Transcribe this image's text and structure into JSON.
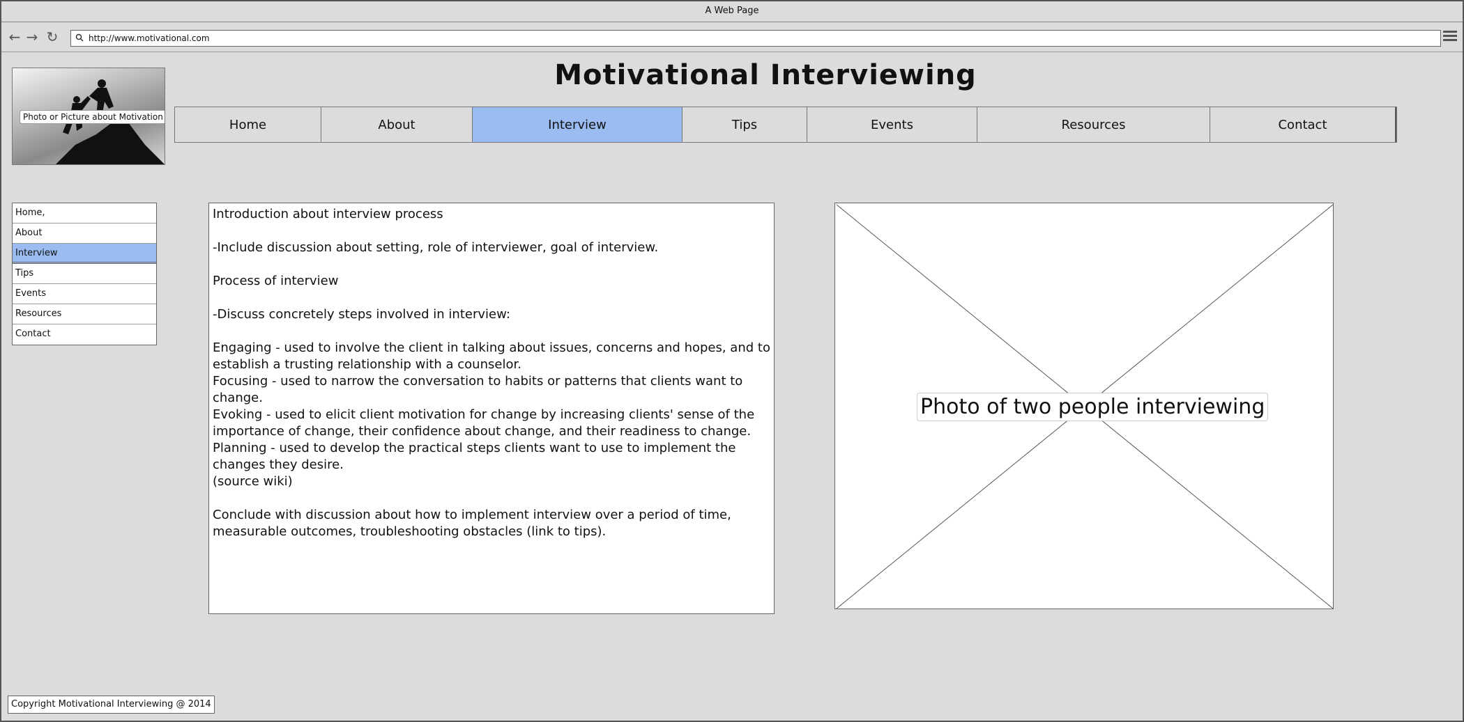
{
  "browser": {
    "window_title": "A Web Page",
    "url": "http://www.motivational.com",
    "icons": [
      "back-arrow-icon",
      "forward-arrow-icon",
      "reload-icon",
      "search-icon",
      "hamburger-menu-icon"
    ]
  },
  "header": {
    "logo_label": "Photo or Picture about Motivation",
    "title": "Motivational Interviewing"
  },
  "topnav": {
    "tabs": [
      {
        "label": "Home"
      },
      {
        "label": "About"
      },
      {
        "label": "Interview"
      },
      {
        "label": "Tips"
      },
      {
        "label": "Events"
      },
      {
        "label": "Resources"
      },
      {
        "label": "Contact"
      }
    ],
    "active": "Interview"
  },
  "sidenav": {
    "items": [
      {
        "label": "Home,"
      },
      {
        "label": "About"
      },
      {
        "label": "Interview"
      },
      {
        "label": "Tips"
      },
      {
        "label": "Events"
      },
      {
        "label": "Resources"
      },
      {
        "label": "Contact"
      }
    ],
    "active": "Interview"
  },
  "content": {
    "paragraphs": [
      "Introduction about interview process",
      "",
      "-Include discussion about setting, role of interviewer, goal of interview.",
      "",
      "Process of interview",
      "",
      "-Discuss concretely steps involved in interview:",
      "",
      "Engaging - used to involve the client in talking about issues, concerns and hopes, and to establish a trusting relationship with a counselor.",
      "Focusing - used to narrow the conversation to habits or patterns that clients want to change.",
      "Evoking - used to elicit client motivation for change by increasing clients' sense of the importance of change, their confidence about change, and their readiness to change.",
      "Planning - used to develop the practical steps clients want to use to implement the changes they desire.",
      "(source wiki)",
      "",
      "Conclude with discussion about how to implement interview over a period of time, measurable outcomes, troubleshooting obstacles (link to tips)."
    ]
  },
  "photo": {
    "label": "Photo of two people interviewing"
  },
  "footer": {
    "copyright": "Copyright Motivational Interviewing @ 2014"
  },
  "colors": {
    "active_tab": "#9abcf1",
    "background": "#dcdcdc"
  }
}
